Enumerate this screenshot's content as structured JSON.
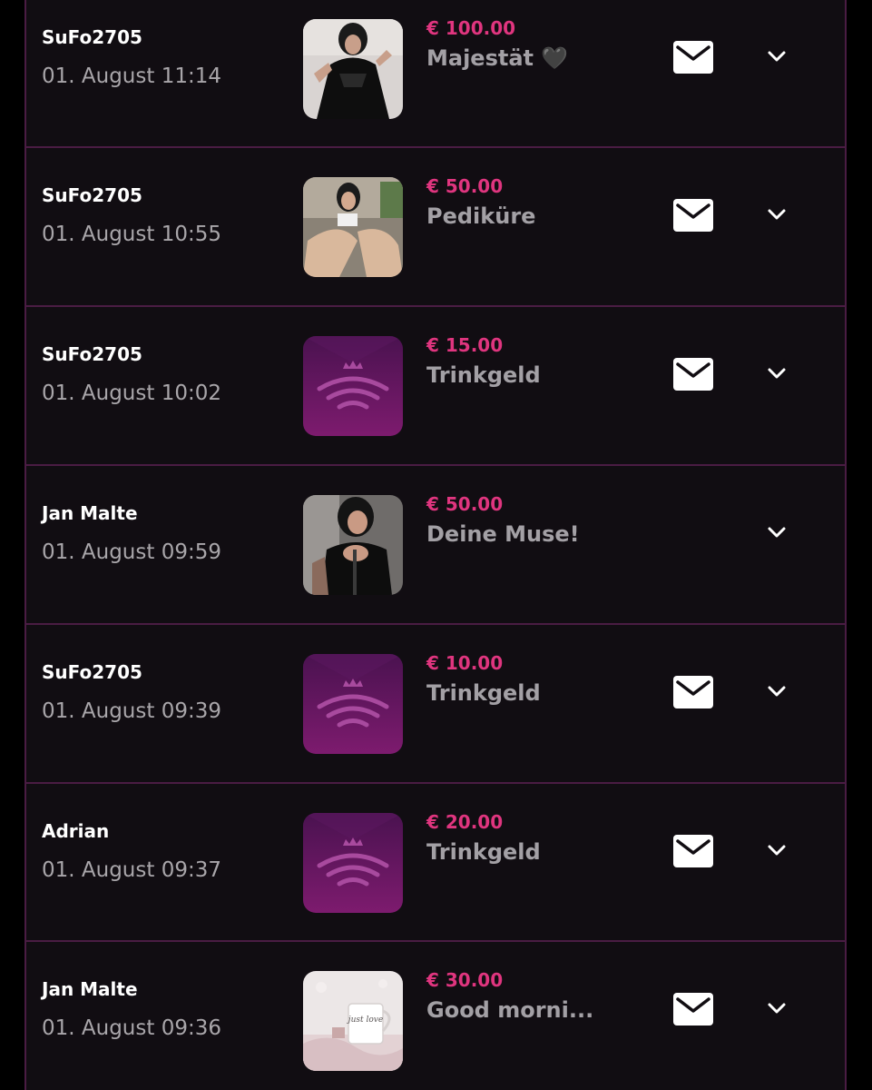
{
  "transactions": [
    {
      "sender": "SuFo2705",
      "date": "01. August 11:14",
      "amount": "€ 100.00",
      "title": "Majestät 🖤",
      "thumbnail": "photo-black-latex-dress",
      "has_mail": true
    },
    {
      "sender": "SuFo2705",
      "date": "01. August 10:55",
      "amount": "€ 50.00",
      "title": "Pediküre",
      "thumbnail": "photo-feet-pedicure",
      "has_mail": true
    },
    {
      "sender": "SuFo2705",
      "date": "01. August 10:02",
      "amount": "€ 15.00",
      "title": "Trinkgeld",
      "thumbnail": "crown-wave-logo",
      "has_mail": true
    },
    {
      "sender": "Jan Malte",
      "date": "01. August 09:59",
      "amount": "€ 50.00",
      "title": "Deine Muse!",
      "thumbnail": "photo-latex-outfit",
      "has_mail": false
    },
    {
      "sender": "SuFo2705",
      "date": "01. August 09:39",
      "amount": "€ 10.00",
      "title": "Trinkgeld",
      "thumbnail": "crown-wave-logo",
      "has_mail": true
    },
    {
      "sender": "Adrian",
      "date": "01. August 09:37",
      "amount": "€ 20.00",
      "title": "Trinkgeld",
      "thumbnail": "crown-wave-logo",
      "has_mail": true
    },
    {
      "sender": "Jan Malte",
      "date": "01. August 09:36",
      "amount": "€ 30.00",
      "title": "Good morni...",
      "thumbnail": "photo-coffee-mug-just-love",
      "has_mail": true
    }
  ],
  "mug_text": "just love",
  "icons": {
    "mail": "envelope-icon",
    "expand": "chevron-down-icon"
  },
  "colors": {
    "background": "#110d12",
    "divider": "#4a1c43",
    "amount": "#e0357f",
    "title": "#a3a0a5",
    "sender": "#ffffff",
    "date": "#a9a6aa"
  }
}
